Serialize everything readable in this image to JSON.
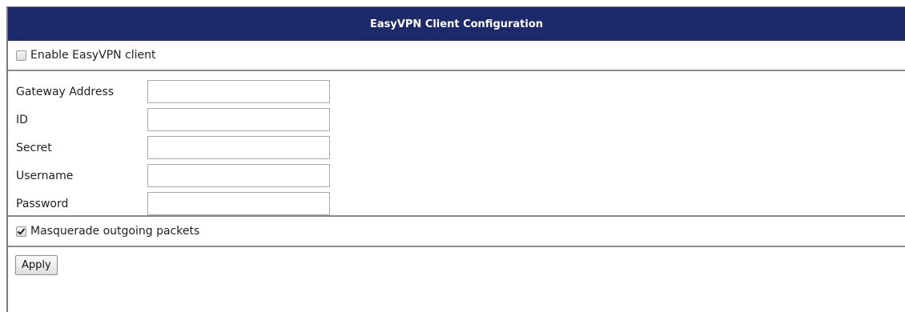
{
  "title": "EasyVPN Client Configuration",
  "enable": {
    "label": "Enable EasyVPN client",
    "checked": false
  },
  "fields": [
    {
      "label": "Gateway Address",
      "value": ""
    },
    {
      "label": "ID",
      "value": ""
    },
    {
      "label": "Secret",
      "value": ""
    },
    {
      "label": "Username",
      "value": ""
    },
    {
      "label": "Password",
      "value": ""
    }
  ],
  "masquerade": {
    "label": "Masquerade outgoing packets",
    "checked": true
  },
  "apply": {
    "label": "Apply"
  },
  "colors": {
    "title_bar": "#1c2a6b",
    "title_text": "#ffffff",
    "separator": "#8a8a8a"
  }
}
